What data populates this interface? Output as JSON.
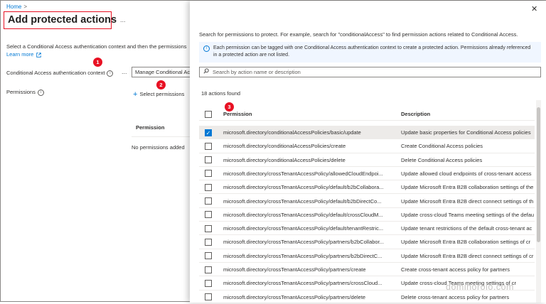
{
  "breadcrumb": {
    "home": "Home",
    "separator": ">"
  },
  "page": {
    "title": "Add protected actions",
    "more": "...",
    "description": "Select a Conditional Access authentication context and then the permissions",
    "learn_more": "Learn more"
  },
  "form": {
    "ctx_label": "Conditional Access authentication context",
    "ctx_info": "i",
    "ctx_more": "...",
    "ctx_value": "Manage Conditional Ac",
    "perm_label": "Permissions",
    "perm_info": "i",
    "select_plus": "+",
    "select_label": "Select permissions",
    "column_permission": "Permission",
    "empty_text": "No permissions added"
  },
  "badges": [
    "1",
    "2",
    "3"
  ],
  "panel": {
    "close": "✕",
    "search_hint": "Search for permissions to protect. For example, search for \"conditionalAccess\" to find permission actions related to Conditional Access.",
    "info_icon": "i",
    "info_text": "Each permission can be tagged with one Conditional Access authentication context to create a protected action. Permissions already referenced in a protected action are not listed.",
    "search_placeholder": "Search by action name or description",
    "found": "18 actions found",
    "columns": {
      "permission": "Permission",
      "description": "Description"
    },
    "rows": [
      {
        "permission": "microsoft.directory/conditionalAccessPolicies/basic/update",
        "description": "Update basic properties for Conditional Access policies",
        "checked": true
      },
      {
        "permission": "microsoft.directory/conditionalAccessPolicies/create",
        "description": "Create Conditional Access policies",
        "checked": false
      },
      {
        "permission": "microsoft.directory/conditionalAccessPolicies/delete",
        "description": "Delete Conditional Access policies",
        "checked": false
      },
      {
        "permission": "microsoft.directory/crossTenantAccessPolicy/allowedCloudEndpoi...",
        "description": "Update allowed cloud endpoints of cross-tenant access",
        "checked": false
      },
      {
        "permission": "microsoft.directory/crossTenantAccessPolicy/default/b2bCollabora...",
        "description": "Update Microsoft Entra B2B collaboration settings of the",
        "checked": false
      },
      {
        "permission": "microsoft.directory/crossTenantAccessPolicy/default/b2bDirectCo...",
        "description": "Update Microsoft Entra B2B direct connect settings of th",
        "checked": false
      },
      {
        "permission": "microsoft.directory/crossTenantAccessPolicy/default/crossCloudM...",
        "description": "Update cross-cloud Teams meeting settings of the defau",
        "checked": false
      },
      {
        "permission": "microsoft.directory/crossTenantAccessPolicy/default/tenantRestric...",
        "description": "Update tenant restrictions of the default cross-tenant ac",
        "checked": false
      },
      {
        "permission": "microsoft.directory/crossTenantAccessPolicy/partners/b2bCollabor...",
        "description": "Update Microsoft Entra B2B collaboration settings of cr",
        "checked": false
      },
      {
        "permission": "microsoft.directory/crossTenantAccessPolicy/partners/b2bDirectC...",
        "description": "Update Microsoft Entra B2B direct connect settings of cr",
        "checked": false
      },
      {
        "permission": "microsoft.directory/crossTenantAccessPolicy/partners/create",
        "description": "Create cross-tenant access policy for partners",
        "checked": false
      },
      {
        "permission": "microsoft.directory/crossTenantAccessPolicy/partners/crossCloud...",
        "description": "Update cross-cloud Teams meeting settings of cr",
        "checked": false
      },
      {
        "permission": "microsoft.directory/crossTenantAccessPolicy/partners/delete",
        "description": "Delete cross-tenant access policy for partners",
        "checked": false
      }
    ]
  },
  "watermark": "dominorolo.com"
}
